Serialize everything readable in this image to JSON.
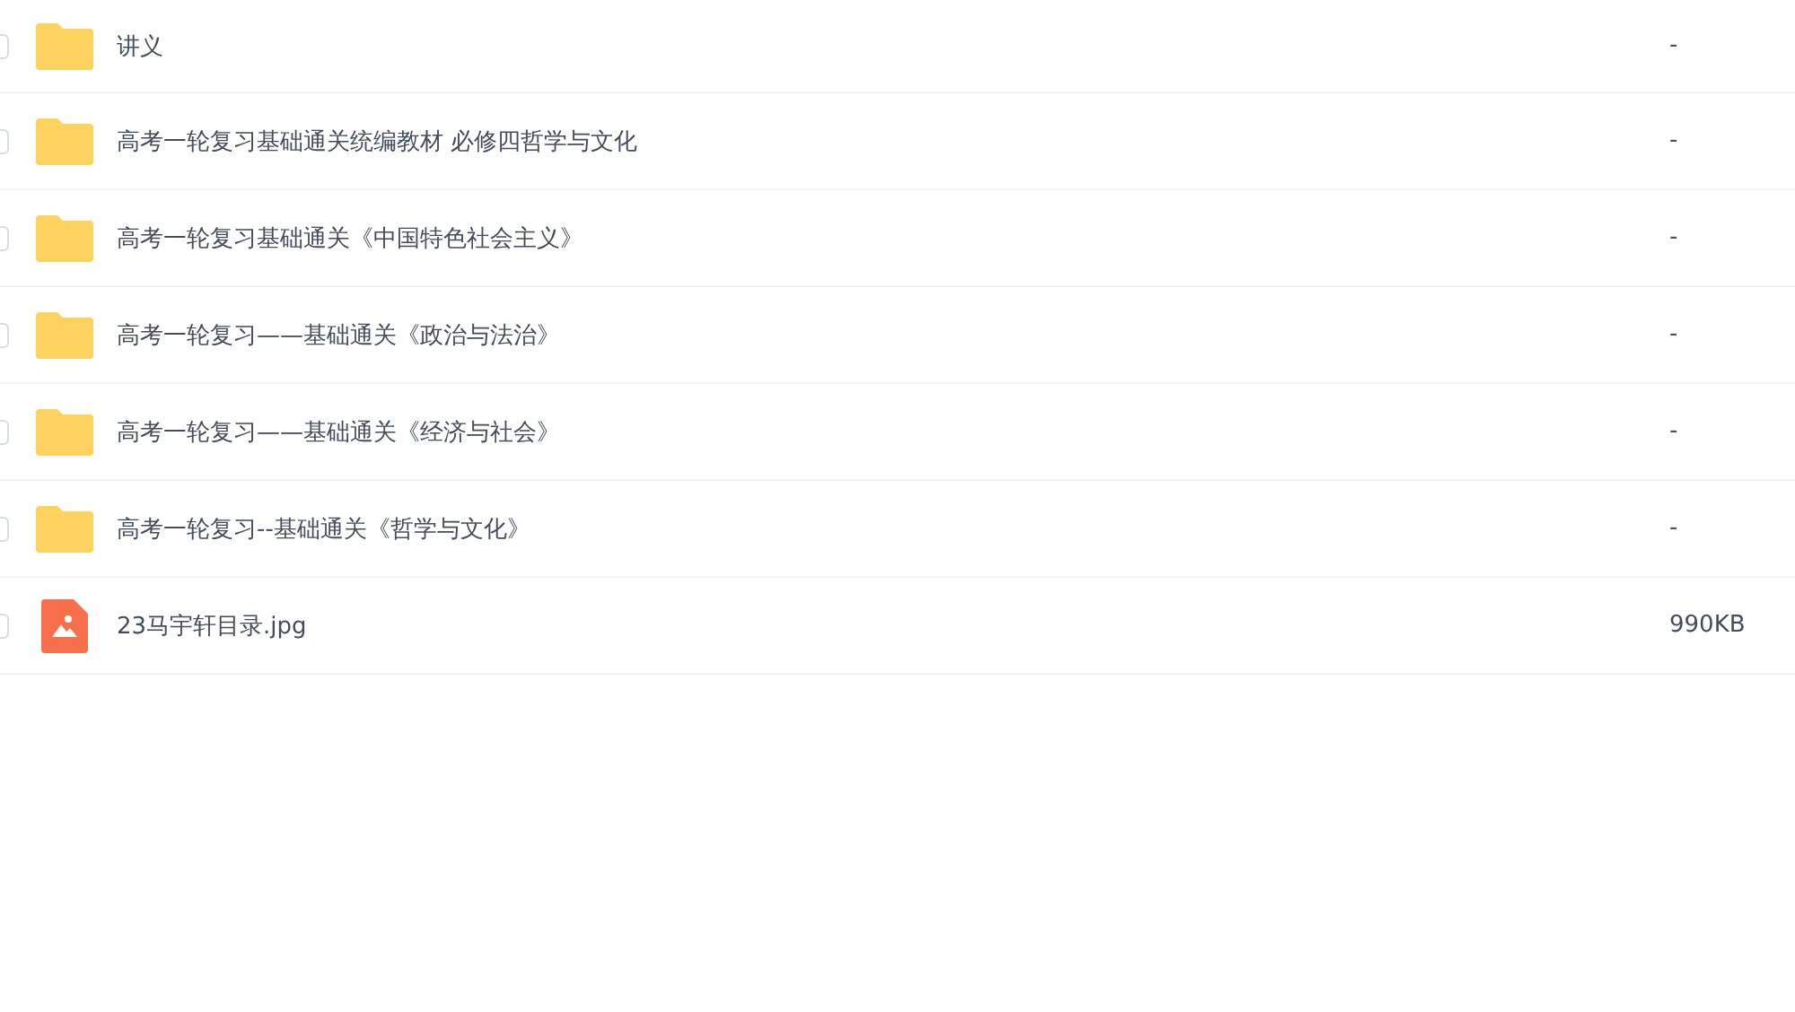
{
  "files": [
    {
      "kind": "folder",
      "name": "讲义",
      "size": "-",
      "checked": false
    },
    {
      "kind": "folder",
      "name": "高考一轮复习基础通关统编教材 必修四哲学与文化",
      "size": "-",
      "checked": false
    },
    {
      "kind": "folder",
      "name": "高考一轮复习基础通关《中国特色社会主义》",
      "size": "-",
      "checked": false
    },
    {
      "kind": "folder",
      "name": "高考一轮复习——基础通关《政治与法治》",
      "size": "-",
      "checked": false
    },
    {
      "kind": "folder",
      "name": "高考一轮复习——基础通关《经济与社会》",
      "size": "-",
      "checked": false
    },
    {
      "kind": "folder",
      "name": "高考一轮复习--基础通关《哲学与文化》",
      "size": "-",
      "checked": false
    },
    {
      "kind": "image",
      "name": "23马宇轩目录.jpg",
      "size": "990KB",
      "checked": false
    }
  ]
}
